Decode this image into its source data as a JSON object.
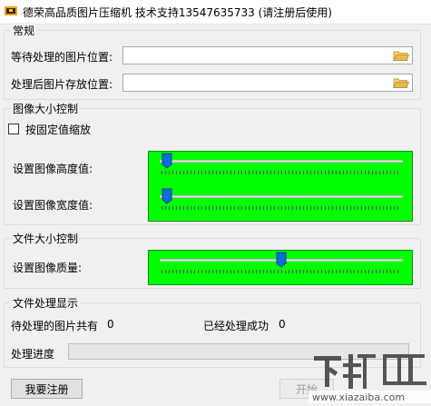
{
  "window": {
    "title": "德荣高品质图片压缩机 技术支持13547635733 (请注册后使用)",
    "icon": "app-icon"
  },
  "general": {
    "group_title": "常规",
    "source_label": "等待处理的图片位置:",
    "source_value": "",
    "output_label": "处理后图片存放位置:",
    "output_value": ""
  },
  "image_size": {
    "group_title": "图像大小控制",
    "fixed_scale_label": "按固定值缩放",
    "fixed_scale_checked": false,
    "height_label": "设置图像高度值:",
    "height_value_fraction": 0.03,
    "width_label": "设置图像宽度值:",
    "width_value_fraction": 0.03,
    "panel_color": "#00ff00"
  },
  "file_size": {
    "group_title": "文件大小控制",
    "quality_label": "设置图像质量:",
    "quality_value_fraction": 0.5
  },
  "status": {
    "group_title": "文件处理显示",
    "pending_label": "待处理的图片共有",
    "pending_count": "0",
    "done_label": "已经处理成功",
    "done_count": "0",
    "progress_label": "处理进度",
    "progress_fraction": 0
  },
  "buttons": {
    "register": "我要注册",
    "start": "开始"
  },
  "watermark": {
    "text": "下载吧",
    "url": "www.xiazaiba.com"
  }
}
